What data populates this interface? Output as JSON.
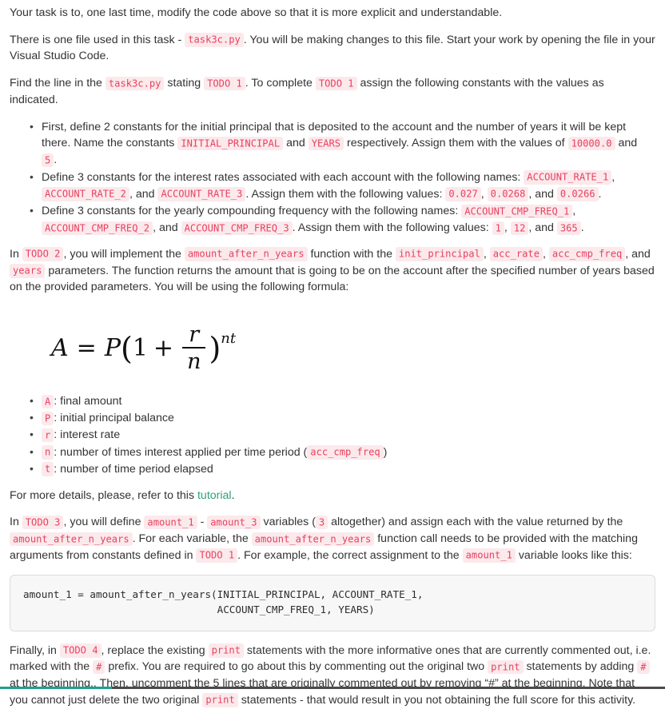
{
  "intro": {
    "line1": "Your task is to, one last time, modify the code above so that it is more explicit and understandable.",
    "file_para_a": "There is one file used in this task - ",
    "file_name": "task3c.py",
    "file_para_b": ". You will be making changes to this file. Start your work by opening the file in your Visual Studio Code.",
    "find_a": "Find the line in the ",
    "find_file": "task3c.py",
    "find_b": " stating ",
    "todo1_a": "TODO 1",
    "find_c": ". To complete ",
    "todo1_b": "TODO 1",
    "find_d": " assign the following constants with the values as indicated."
  },
  "constants_list": [
    {
      "seg1": "First, define 2 constants for the initial principal that is deposited to the account and the number of years it will be kept there. Name the constants ",
      "code1": "INITIAL_PRINCIPAL",
      "seg2": " and ",
      "code2": "YEARS",
      "seg3": " respectively. Assign them with the values of ",
      "code3": "10000.0",
      "seg4": " and ",
      "code4": "5",
      "seg5": "."
    },
    {
      "seg1": "Define 3 constants for the interest rates associated with each account with the following names: ",
      "code1": "ACCOUNT_RATE_1",
      "seg2": ", ",
      "code2": "ACCOUNT_RATE_2",
      "seg3": ", and ",
      "code3": "ACCOUNT_RATE_3",
      "seg4": ". Assign them with the following values: ",
      "code4": "0.027",
      "seg5": ", ",
      "code5": "0.0268",
      "seg6": ", and ",
      "code6": "0.0266",
      "seg7": "."
    },
    {
      "seg1": "Define 3 constants for the yearly compounding frequency with the following names: ",
      "code1": "ACCOUNT_CMP_FREQ_1",
      "seg2": ", ",
      "code2": "ACCOUNT_CMP_FREQ_2",
      "seg3": ", and ",
      "code3": "ACCOUNT_CMP_FREQ_3",
      "seg4": ". Assign them with the following values: ",
      "code4": "1",
      "seg5": ", ",
      "code5": "12",
      "seg6": ", and ",
      "code6": "365",
      "seg7": "."
    }
  ],
  "todo2": {
    "a": "In ",
    "chip_todo": "TODO 2",
    "b": ", you will implement the ",
    "chip_fn": "amount_after_n_years",
    "c": " function with the ",
    "chip_p1": "init_principal",
    "d": ", ",
    "chip_p2": "acc_rate",
    "e": ", ",
    "chip_p3": "acc_cmp_freq",
    "f": ", and ",
    "chip_p4": "years",
    "g": " parameters. The function returns the amount that is going to be on the account after the specified number of years based on the provided parameters. You will be using the following formula:"
  },
  "formula": {
    "lhs": "A",
    "eq": "=",
    "principal": "P",
    "open_paren": "(",
    "one": "1",
    "plus": "+",
    "numerator": "r",
    "denominator": "n",
    "close_paren": ")",
    "exponent": "nt",
    "alt_text": "A = P(1 + r/n)^nt"
  },
  "variable_defs": [
    {
      "symbol": "A",
      "text": ": final amount"
    },
    {
      "symbol": "P",
      "text": ": initial principal balance"
    },
    {
      "symbol": "r",
      "text": ": interest rate"
    },
    {
      "symbol": "n",
      "text": ": number of times interest applied per time period (",
      "code_suffix": "acc_cmp_freq",
      "tail": ")"
    },
    {
      "symbol": "t",
      "text": ": number of time period elapsed"
    }
  ],
  "tutorial": {
    "a": "For more details, please, refer to this ",
    "link": "tutorial",
    "b": "."
  },
  "todo3": {
    "a": "In ",
    "chip_todo": "TODO 3",
    "b": ", you will define ",
    "chip_v1": "amount_1",
    "c": " - ",
    "chip_v3": "amount_3",
    "d": " variables (",
    "chip_count": "3",
    "e": " altogether) and assign each with the value returned by the ",
    "chip_fn1": "amount_after_n_years",
    "f": ". For each variable, the ",
    "chip_fn2": "amount_after_n_years",
    "g": " function call needs to be provided with the matching arguments from constants defined in ",
    "chip_todo1": "TODO 1",
    "h": ". For example, the correct assignment to the ",
    "chip_var": "amount_1",
    "i": " variable looks like this:"
  },
  "code_block": "amount_1 = amount_after_n_years(INITIAL_PRINCIPAL, ACCOUNT_RATE_1,\n                                ACCOUNT_CMP_FREQ_1, YEARS)",
  "todo4": {
    "a": "Finally, in ",
    "chip_todo": "TODO 4",
    "b": ", replace the existing ",
    "chip_print1": "print",
    "c": " statements with the more informative ones that are currently commented out, i.e. marked with the ",
    "chip_hash1": "#",
    "d": " prefix. You are required to go about this by commenting out the original two ",
    "chip_print2": "print",
    "e": " statements by adding ",
    "chip_hash2": "#",
    "f": " at the beginning.. Then, uncomment the 5 lines that are originally commented out by removing “#” at the beginning. Note that you cannot just delete the two original ",
    "chip_print3": "print",
    "g": " statements - that would result in you not obtaining the full score for this activity."
  },
  "colors": {
    "chip_bg": "#fbe9ec",
    "chip_fg": "#e8415e",
    "link": "#2e9e7e",
    "body": "#333333",
    "code_bg": "#f7f7f8",
    "code_border": "#dcdcdc",
    "rule_dark": "#4a4a4a",
    "rule_accent": "#1f9e92"
  }
}
